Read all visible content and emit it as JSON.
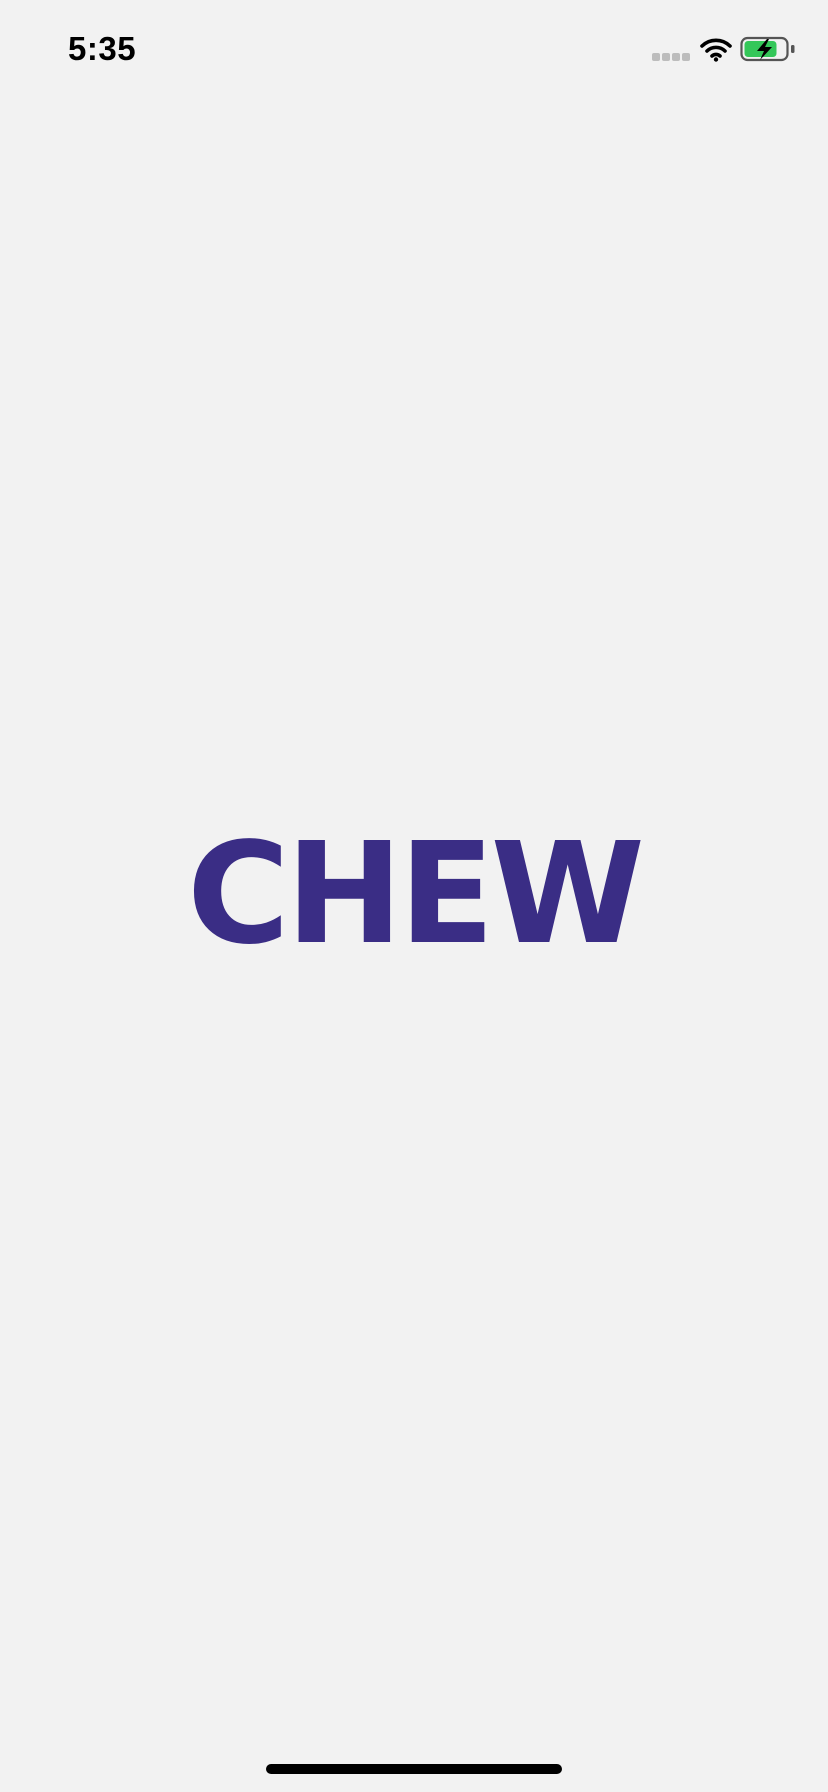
{
  "status_bar": {
    "time": "5:35",
    "signal_icon": "cellular-signal-icon",
    "wifi_icon": "wifi-icon",
    "battery_icon": "battery-charging-icon",
    "battery_fill_fraction": 0.8,
    "battery_color": "#34c759"
  },
  "logo": {
    "text": "CHEW",
    "color": "#3a2d85"
  },
  "colors": {
    "background": "#f2f2f2",
    "brand": "#3a2d85"
  }
}
